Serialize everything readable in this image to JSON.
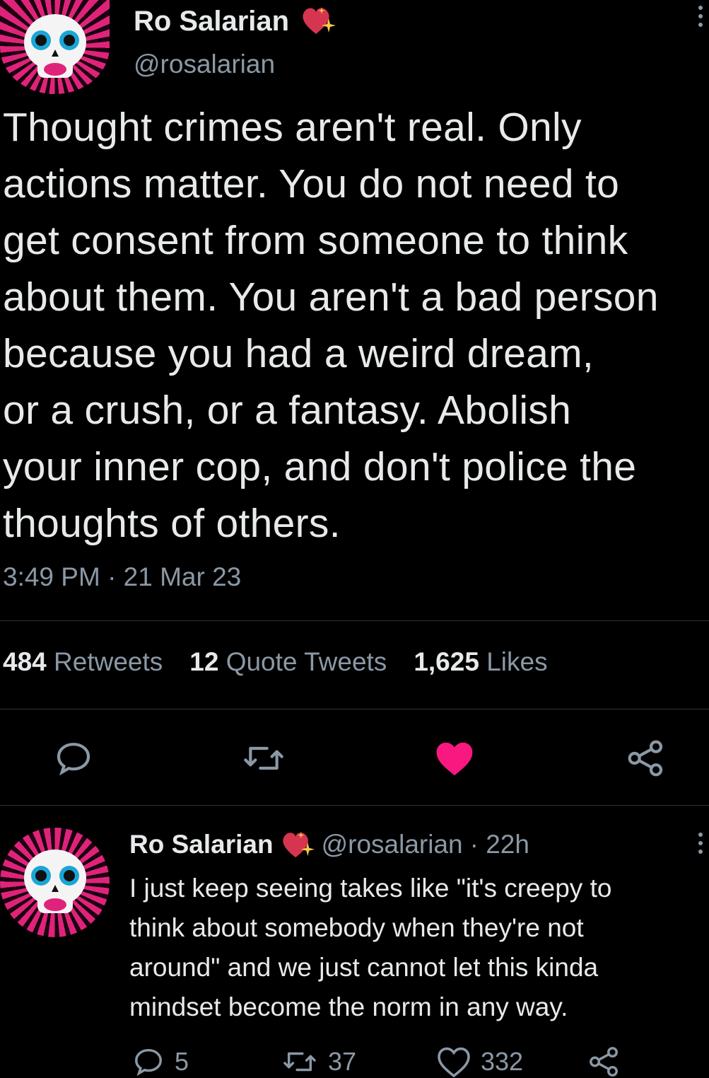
{
  "main_tweet": {
    "author_name": "Ro Salarian",
    "author_handle": "@rosalarian",
    "text": "Thought crimes aren't real. Only\nactions matter. You do not need to\nget consent from someone to think\nabout them. You aren't a bad person\nbecause you had a weird dream,\nor a crush, or a fantasy. Abolish\nyour inner cop, and don't police the\nthoughts of others.",
    "timestamp": "3:49 PM · 21 Mar 23",
    "stats": {
      "retweets_count": "484",
      "retweets_label": "Retweets",
      "quotes_count": "12",
      "quotes_label": "Quote Tweets",
      "likes_count": "1,625",
      "likes_label": "Likes"
    },
    "liked": true
  },
  "reply": {
    "author_name": "Ro Salarian",
    "author_handle": "@rosalarian",
    "time": "· 22h",
    "text": "I just keep seeing takes like \"it's creepy to\nthink about somebody when they're not\naround\" and we just cannot let this kinda\nmindset become the norm in any way.",
    "reply_count": "5",
    "retweet_count": "37",
    "like_count": "332"
  },
  "colors": {
    "background": "#000000",
    "text": "#e7e9ea",
    "secondary": "#8b98a5",
    "like": "#f91880",
    "divider": "#2f3336"
  },
  "icons": [
    "more-icon",
    "heart-sparkle-icon",
    "reply-icon",
    "retweet-icon",
    "like-icon",
    "share-icon"
  ]
}
